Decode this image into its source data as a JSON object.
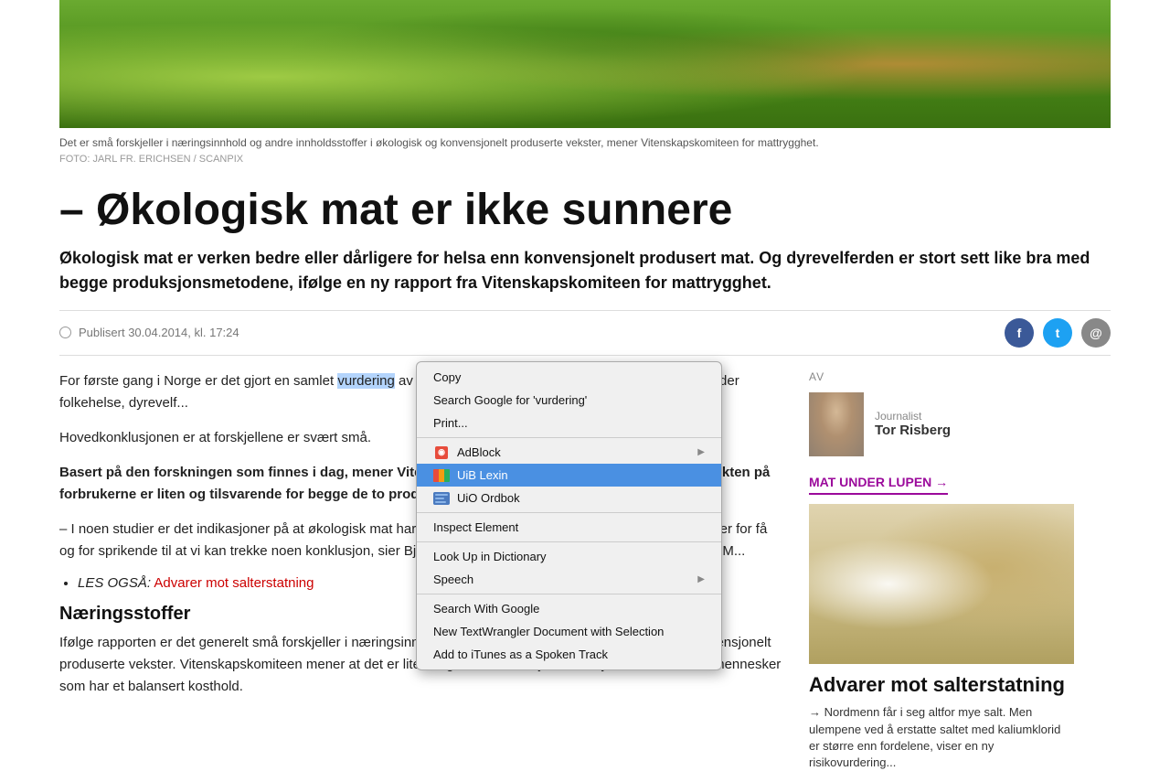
{
  "hero": {
    "caption": "Det er små forskjeller i næringsinnhold og andre innholdsstoffer i økologisk og konvensjonelt produserte vekster, mener Vitenskapskomiteen for mattrygghet.",
    "photo_credit": "FOTO: JARL FR. ERICHSEN / SCANPIX"
  },
  "article": {
    "headline": "– Økologisk mat er ikke sunnere",
    "subheadline": "Økologisk mat er verken bedre eller dårligere for helsa enn konvensjonelt produsert mat. Og dyrevelferden er stort sett like bra med begge produksjonsmetodene, ifølge en ny rapport fra Vitenskapskomiteen for mattrygghet.",
    "publish_label": "Publisert 30.04.2014, kl. 17:24",
    "body_1": "For første gang i Norge er det gjort en samlet vurdering",
    "body_1_rest": " av forskjellene mellom konvensjonell mat når det gjelder folkehelse, dyrevelf...",
    "body_2": "Hovedkonklusjonen er at forskjellene er svært små.",
    "body_bold": "Basert på den forskningen som finnes i dag, mener Vitenskapskomiteen for mattrygghet (VKM) at effekten på forbrukerne er liten og tilsvarende for begge de to produksjonsmetodene.",
    "body_3": "– I noen studier er det indikasjoner på at økologisk mat har litt bedre effekt på immunsystemet. Men funnene er for få og for sprikende til at vi kan trekke noen konklusjon, sier Bjørn Næss, som er medlem av hovedkomiteen i VKM...",
    "list_item": "LES OGSÅ:",
    "list_link": "Advarer mot salterstatning",
    "section_title": "Næringsstoffer",
    "body_4": "Ifølge rapporten er det generelt små forskjeller i næringsinnhold og andre innholdsstoffer i økologisk og konvensjonelt produserte vekster. Vitenskapskomiteen mener at det er lite trolig at disse forskjellene betyr noe for helsa til mennesker som har et balansert kosthold.",
    "highlight_word": "vurdering"
  },
  "context_menu": {
    "items": [
      {
        "id": "copy",
        "label": "Copy",
        "has_icon": false,
        "has_arrow": false,
        "active": false
      },
      {
        "id": "search-google",
        "label": "Search Google for 'vurdering'",
        "has_icon": false,
        "has_arrow": false,
        "active": false
      },
      {
        "id": "print",
        "label": "Print...",
        "has_icon": false,
        "has_arrow": false,
        "active": false
      },
      {
        "id": "separator1",
        "type": "separator"
      },
      {
        "id": "adblock",
        "label": "AdBlock",
        "has_icon": true,
        "icon_type": "adblock",
        "has_arrow": true,
        "active": false
      },
      {
        "id": "uib-lexin",
        "label": "UiB Lexin",
        "has_icon": true,
        "icon_type": "uib",
        "has_arrow": false,
        "active": true
      },
      {
        "id": "uio-ordbok",
        "label": "UiO Ordbok",
        "has_icon": true,
        "icon_type": "uio",
        "has_arrow": false,
        "active": false
      },
      {
        "id": "separator2",
        "type": "separator"
      },
      {
        "id": "inspect",
        "label": "Inspect Element",
        "has_icon": false,
        "has_arrow": false,
        "active": false
      },
      {
        "id": "separator3",
        "type": "separator"
      },
      {
        "id": "lookup",
        "label": "Look Up in Dictionary",
        "has_icon": false,
        "has_arrow": false,
        "active": false
      },
      {
        "id": "speech",
        "label": "Speech",
        "has_icon": false,
        "has_arrow": true,
        "active": false
      },
      {
        "id": "separator4",
        "type": "separator"
      },
      {
        "id": "search-with-google",
        "label": "Search With Google",
        "has_icon": false,
        "has_arrow": false,
        "active": false
      },
      {
        "id": "new-textwrangler",
        "label": "New TextWrangler Document with Selection",
        "has_icon": false,
        "has_arrow": false,
        "active": false
      },
      {
        "id": "add-itunes",
        "label": "Add to iTunes as a Spoken Track",
        "has_icon": false,
        "has_arrow": false,
        "active": false
      }
    ]
  },
  "sidebar": {
    "av_label": "AV",
    "author_role": "Journalist",
    "author_name": "Tor Risberg",
    "section_link": "MAT UNDER LUPEN →",
    "sidebar_article_title": "Advarer mot salterstatning",
    "sidebar_article_blurb": "→ Nordmenn får i seg altfor mye salt. Men ulempene ved å erstatte saltet med kaliumklorid er større enn fordelene, viser en ny risikovurdering..."
  },
  "social": {
    "facebook": "f",
    "twitter": "t",
    "email": "@"
  }
}
